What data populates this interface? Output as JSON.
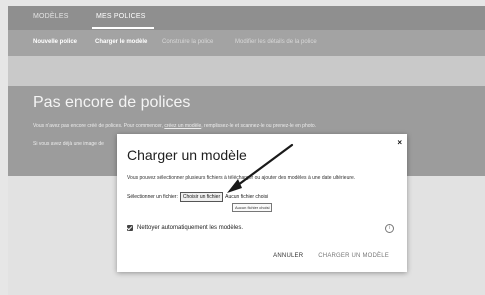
{
  "top_tabs": [
    {
      "label": "MODÈLES"
    },
    {
      "label": "MES POLICES"
    }
  ],
  "sub_tabs": [
    {
      "label": "Nouvelle police"
    },
    {
      "label": "Charger le modèle"
    },
    {
      "label": "Construire la police"
    },
    {
      "label": "Modifier les détails de la police"
    }
  ],
  "hero": {
    "title": "Pas encore de polices",
    "line1_pre": "Vous n'avez pas encore créé de polices. Pour commencer,",
    "line1_link": "créez un modèle",
    "line1_post": ", remplissez-le et scannez-le ou prenez-le en photo.",
    "line2": "Si vous avez déjà une image de"
  },
  "dialog": {
    "title": "Charger un modèle",
    "description": "Vous pouvez sélectionner plusieurs fichiers à télécharger ou ajouter des modèles à une date ultérieure.",
    "file_label": "Sélectionner un fichier:",
    "choose_file_button": "Choisir un fichier",
    "no_file_text": "Aucun fichier choisi",
    "tooltip": "Aucun fichier choisi",
    "auto_clean_label": "Nettoyer automatiquement les modèles.",
    "cancel_label": "ANNULER",
    "upload_label": "CHARGER UN MODÈLE",
    "close_icon": "×"
  },
  "colors": {
    "top_nav": "#8f8f8f",
    "sub_nav": "#a3a3a3",
    "hero": "#9c9c9c",
    "dialog": "#ffffff"
  }
}
